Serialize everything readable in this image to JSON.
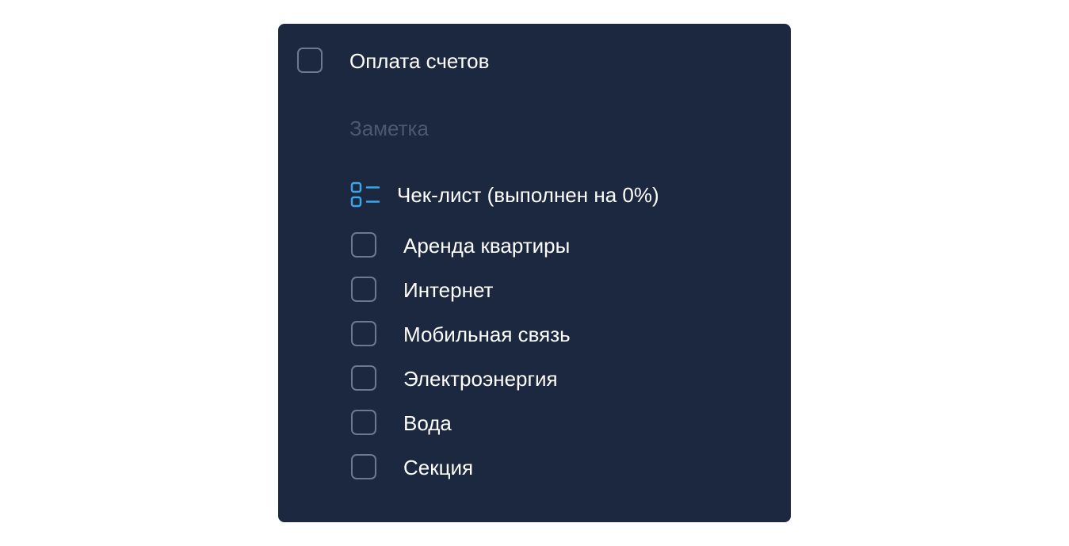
{
  "task": {
    "title": "Оплата счетов",
    "checked": false
  },
  "note": {
    "placeholder": "Заметка",
    "value": ""
  },
  "checklist": {
    "header": "Чек-лист (выполнен на 0%)",
    "progress_percent": 0,
    "items": [
      {
        "label": "Аренда квартиры",
        "checked": false
      },
      {
        "label": "Интернет",
        "checked": false
      },
      {
        "label": "Мобильная связь",
        "checked": false
      },
      {
        "label": "Электроэнергия",
        "checked": false
      },
      {
        "label": "Вода",
        "checked": false
      },
      {
        "label": "Секция",
        "checked": false
      }
    ]
  },
  "colors": {
    "card_background": "#1c2740",
    "checkbox_border": "#6b7a93",
    "text": "#ffffff",
    "placeholder": "#4b5872",
    "accent_icon": "#3aa7e8"
  }
}
